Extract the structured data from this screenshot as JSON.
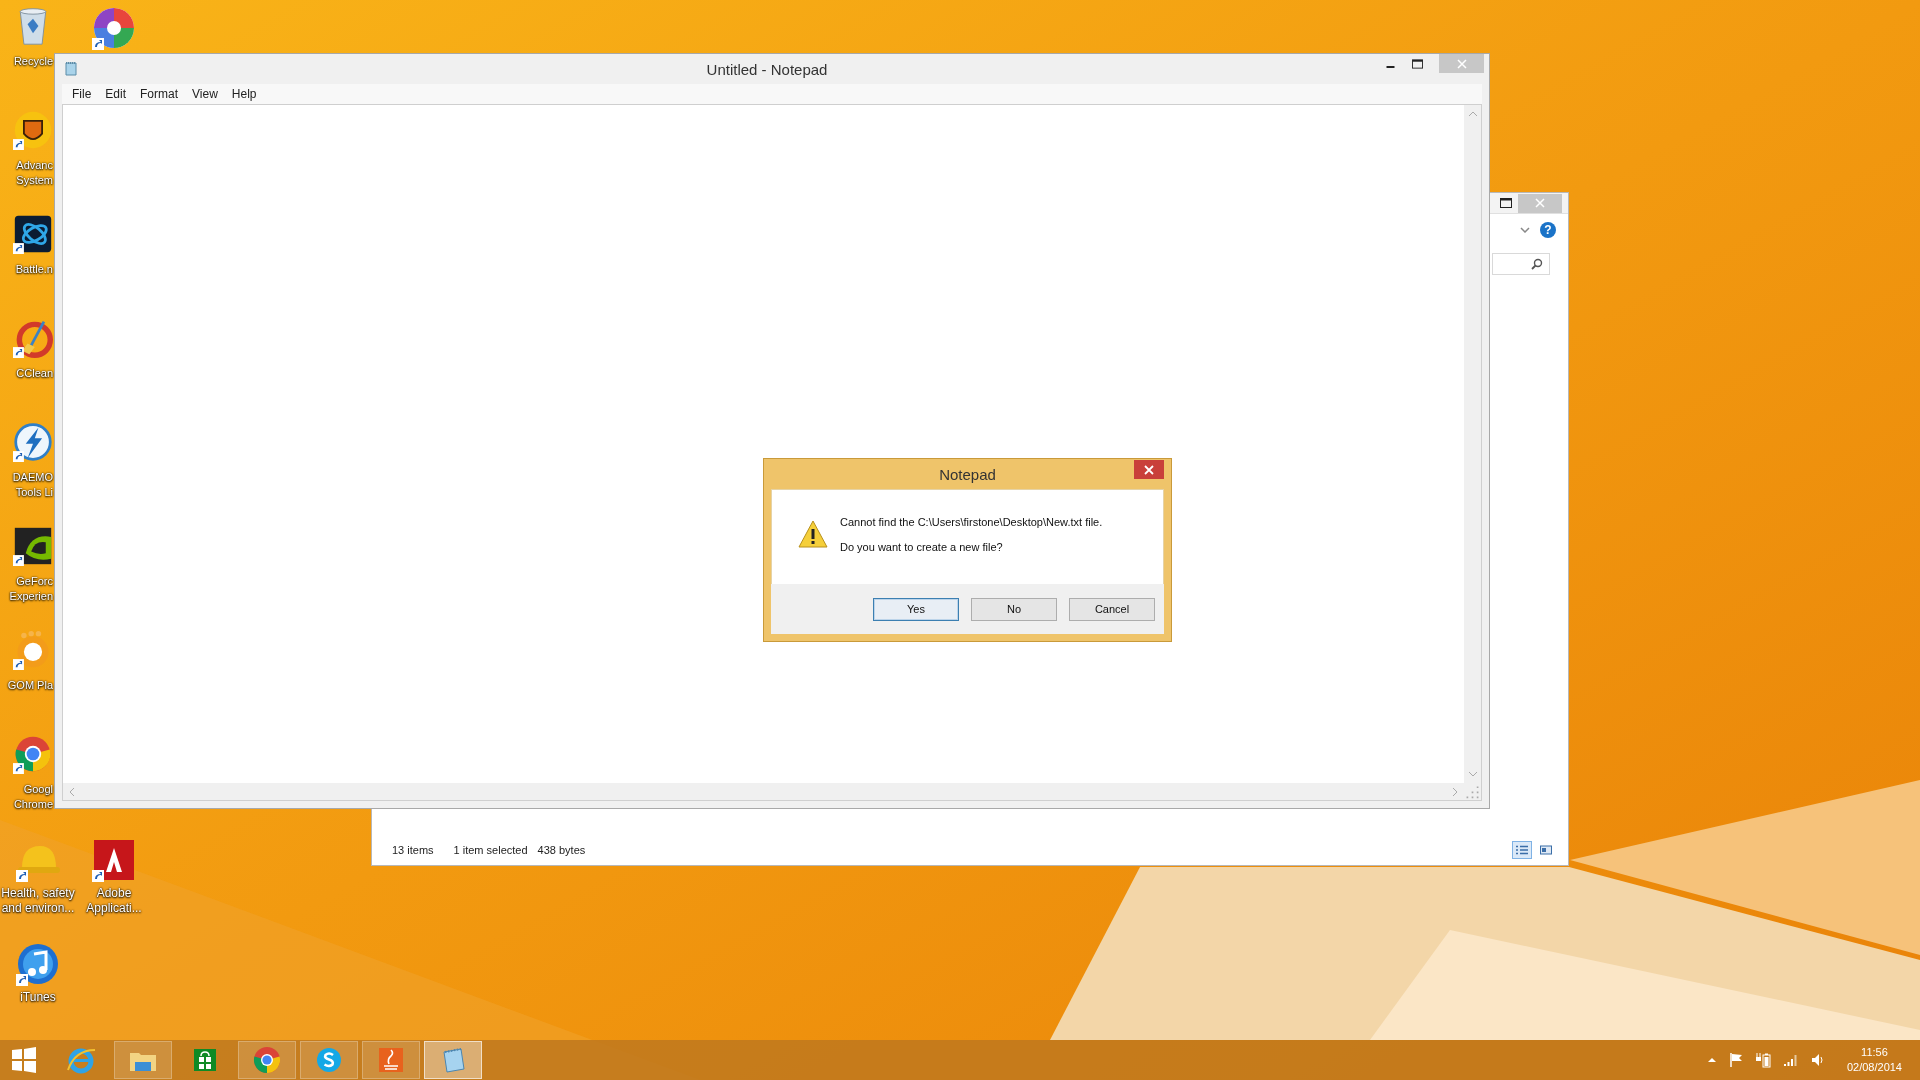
{
  "desktop_icons": [
    {
      "kind": "recycle",
      "lines": [
        "Recycle"
      ],
      "shortcut": false
    },
    {
      "kind": "shield",
      "lines": [
        "Advanc",
        "System"
      ],
      "shortcut": true
    },
    {
      "kind": "battlenet",
      "lines": [
        "Battle.n"
      ],
      "shortcut": true
    },
    {
      "kind": "ccleaner",
      "lines": [
        "CClean"
      ],
      "shortcut": true
    },
    {
      "kind": "daemon",
      "lines": [
        "DAEMO",
        "Tools Li"
      ],
      "shortcut": true
    },
    {
      "kind": "nvidia",
      "lines": [
        "GeForc",
        "Experien"
      ],
      "shortcut": true
    },
    {
      "kind": "gom",
      "lines": [
        "GOM Pla"
      ],
      "shortcut": true
    },
    {
      "kind": "chrome",
      "lines": [
        "Googl",
        "Chrome"
      ],
      "shortcut": true
    },
    {
      "kind": "hardhat",
      "lines": [
        "Health, safety",
        "and environ..."
      ],
      "shortcut": true
    },
    {
      "kind": "itunes",
      "lines": [
        "iTunes"
      ],
      "shortcut": true
    }
  ],
  "desktop_icons_right": [
    {
      "kind": "picasa",
      "shortcut": true
    },
    {
      "kind": "adobe",
      "lines": [
        "Adobe",
        "Applicati..."
      ],
      "shortcut": true
    }
  ],
  "explorer": {
    "help_glyph": "?",
    "status_items": [
      "13 items",
      "1 item selected",
      "438 bytes"
    ],
    "views": [
      {
        "kind": "details",
        "selected": true
      },
      {
        "kind": "tiles",
        "selected": false
      }
    ]
  },
  "notepad": {
    "title": "Untitled - Notepad",
    "menu": [
      "File",
      "Edit",
      "Format",
      "View",
      "Help"
    ]
  },
  "dialog": {
    "title": "Notepad",
    "message": "Cannot find the C:\\Users\\firstone\\Desktop\\New.txt file.",
    "question": "Do you want to create a new file?",
    "buttons": [
      {
        "label": "Yes",
        "focused": true
      },
      {
        "label": "No",
        "focused": false
      },
      {
        "label": "Cancel",
        "focused": false
      }
    ]
  },
  "taskbar": {
    "items": [
      {
        "kind": "start",
        "running": false,
        "selected": false
      },
      {
        "kind": "ie",
        "running": false,
        "selected": false
      },
      {
        "kind": "explorer",
        "running": true,
        "selected": false
      },
      {
        "kind": "store",
        "running": false,
        "selected": false
      },
      {
        "kind": "chrome",
        "running": true,
        "selected": false
      },
      {
        "kind": "skype",
        "running": true,
        "selected": false
      },
      {
        "kind": "java",
        "running": true,
        "selected": false
      },
      {
        "kind": "notepad",
        "running": true,
        "selected": true
      }
    ],
    "time": "11:56",
    "date": "02/08/2014"
  }
}
